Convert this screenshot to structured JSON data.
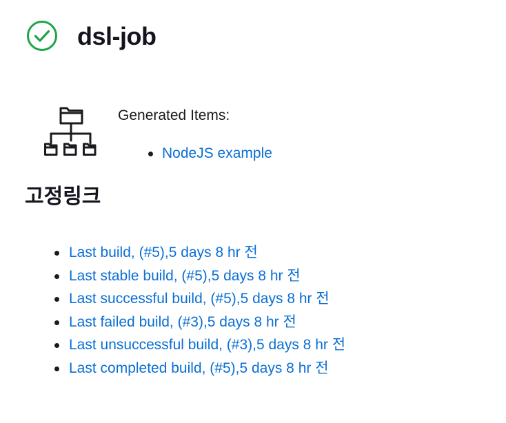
{
  "job": {
    "title": "dsl-job",
    "status_icon": "check-circle-icon",
    "status_color": "#1ea446"
  },
  "generated": {
    "icon": "hierarchy-folder-icon",
    "label": "Generated Items:",
    "items": [
      {
        "label": "NodeJS example"
      }
    ]
  },
  "permalinks": {
    "title": "고정링크",
    "items": [
      {
        "label": "Last build, (#5),5 days 8 hr 전"
      },
      {
        "label": "Last stable build, (#5),5 days 8 hr 전"
      },
      {
        "label": "Last successful build, (#5),5 days 8 hr 전"
      },
      {
        "label": "Last failed build, (#3),5 days 8 hr 전"
      },
      {
        "label": "Last unsuccessful build, (#3),5 days 8 hr 전"
      },
      {
        "label": "Last completed build, (#5),5 days 8 hr 전"
      }
    ]
  },
  "colors": {
    "link": "#0a6fd4",
    "text": "#1b1b1f"
  }
}
